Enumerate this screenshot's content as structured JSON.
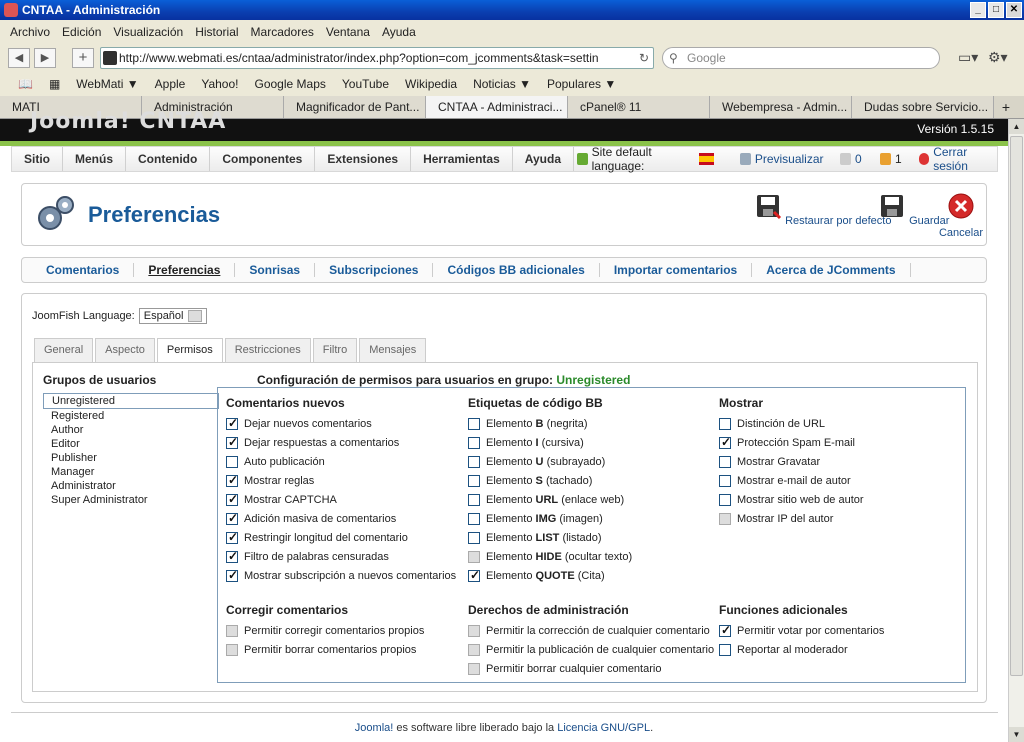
{
  "window": {
    "title": "CNTAA - Administración"
  },
  "menubar": [
    "Archivo",
    "Edición",
    "Visualización",
    "Historial",
    "Marcadores",
    "Ventana",
    "Ayuda"
  ],
  "navbar": {
    "url": "http://www.webmati.es/cntaa/administrator/index.php?option=com_jcomments&task=settin",
    "search_placeholder": "Google"
  },
  "bookmarks": [
    "WebMati ▼",
    "Apple",
    "Yahoo!",
    "Google Maps",
    "YouTube",
    "Wikipedia",
    "Noticias ▼",
    "Populares ▼"
  ],
  "browser_tabs": [
    {
      "label": "MATI",
      "active": false
    },
    {
      "label": "Administración",
      "active": false
    },
    {
      "label": "Magnificador de Pant...",
      "active": false
    },
    {
      "label": "CNTAA - Administraci...",
      "active": true
    },
    {
      "label": "cPanel® 11",
      "active": false
    },
    {
      "label": "Webempresa - Admin...",
      "active": false
    },
    {
      "label": "Dudas sobre Servicio...",
      "active": false
    }
  ],
  "header": {
    "logo": "Joomla! CNTAA",
    "version": "Versión 1.5.15"
  },
  "topmenu": [
    "Sitio",
    "Menús",
    "Contenido",
    "Componentes",
    "Extensiones",
    "Herramientas",
    "Ayuda"
  ],
  "status": {
    "default_language": "Site default language:",
    "preview": "Previsualizar",
    "messages": "0",
    "users": "1",
    "logout": "Cerrar sesión"
  },
  "toolbar": {
    "title": "Preferencias",
    "restore": "Restaurar por defecto",
    "save": "Guardar",
    "cancel": "Cancelar"
  },
  "subtabs": [
    "Comentarios",
    "Preferencias",
    "Sonrisas",
    "Subscripciones",
    "Códigos BB adicionales",
    "Importar comentarios",
    "Acerca de JComments"
  ],
  "joomfish": {
    "label": "JoomFish Language:",
    "value": "Español"
  },
  "content_tabs": [
    "General",
    "Aspecto",
    "Permisos",
    "Restricciones",
    "Filtro",
    "Mensajes"
  ],
  "groups": {
    "title": "Grupos de usuarios",
    "items": [
      "Unregistered",
      "Registered",
      "Author",
      "Editor",
      "Publisher",
      "Manager",
      "Administrator",
      "Super Administrator"
    ]
  },
  "permissions": {
    "title_prefix": "Configuración de permisos para usuarios en grupo:",
    "group": "Unregistered",
    "comments_new": {
      "title": "Comentarios nuevos",
      "items": [
        {
          "label": "Dejar nuevos comentarios",
          "checked": true
        },
        {
          "label": "Dejar respuestas a comentarios",
          "checked": true
        },
        {
          "label": "Auto publicación",
          "checked": false
        },
        {
          "label": "Mostrar reglas",
          "checked": true
        },
        {
          "label": "Mostrar CAPTCHA",
          "checked": true
        },
        {
          "label": "Adición masiva de comentarios",
          "checked": true
        },
        {
          "label": "Restringir longitud del comentario",
          "checked": true
        },
        {
          "label": "Filtro de palabras censuradas",
          "checked": true
        },
        {
          "label": "Mostrar subscripción a nuevos comentarios",
          "checked": true
        }
      ]
    },
    "bb_tags": {
      "title": "Etiquetas de código BB",
      "items": [
        {
          "tag": "B",
          "desc": "(negrita)",
          "checked": false,
          "disabled": false
        },
        {
          "tag": "I",
          "desc": "(cursiva)",
          "checked": false,
          "disabled": false
        },
        {
          "tag": "U",
          "desc": "(subrayado)",
          "checked": false,
          "disabled": false
        },
        {
          "tag": "S",
          "desc": "(tachado)",
          "checked": false,
          "disabled": false
        },
        {
          "tag": "URL",
          "desc": "(enlace web)",
          "checked": false,
          "disabled": false
        },
        {
          "tag": "IMG",
          "desc": "(imagen)",
          "checked": false,
          "disabled": false
        },
        {
          "tag": "LIST",
          "desc": "(listado)",
          "checked": false,
          "disabled": false
        },
        {
          "tag": "HIDE",
          "desc": "(ocultar texto)",
          "checked": false,
          "disabled": true
        },
        {
          "tag": "QUOTE",
          "desc": "(Cita)",
          "checked": true,
          "disabled": false
        }
      ],
      "prefix": "Elemento"
    },
    "show": {
      "title": "Mostrar",
      "items": [
        {
          "label": "Distinción de URL",
          "checked": false,
          "disabled": false
        },
        {
          "label": "Protección Spam E-mail",
          "checked": true,
          "disabled": false
        },
        {
          "label": "Mostrar Gravatar",
          "checked": false,
          "disabled": false
        },
        {
          "label": "Mostrar e-mail de autor",
          "checked": false,
          "disabled": false
        },
        {
          "label": "Mostrar sitio web de autor",
          "checked": false,
          "disabled": false
        },
        {
          "label": "Mostrar IP del autor",
          "checked": false,
          "disabled": true
        }
      ]
    },
    "correct": {
      "title": "Corregir comentarios",
      "items": [
        {
          "label": "Permitir corregir comentarios propios",
          "checked": false,
          "disabled": true
        },
        {
          "label": "Permitir borrar comentarios propios",
          "checked": false,
          "disabled": true
        }
      ]
    },
    "admin": {
      "title": "Derechos de administración",
      "items": [
        {
          "label": "Permitir la corrección de cualquier comentario",
          "checked": false,
          "disabled": true
        },
        {
          "label": "Permitir la publicación de cualquier comentario",
          "checked": false,
          "disabled": true
        },
        {
          "label": "Permitir borrar cualquier comentario",
          "checked": false,
          "disabled": true
        }
      ]
    },
    "extra": {
      "title": "Funciones adicionales",
      "items": [
        {
          "label": "Permitir votar por comentarios",
          "checked": true,
          "disabled": false
        },
        {
          "label": "Reportar al moderador",
          "checked": false,
          "disabled": false
        }
      ]
    }
  },
  "footer": {
    "joomla": "Joomla!",
    "middle": " es software libre liberado bajo la ",
    "license": "Licencia GNU/GPL",
    "end": "."
  }
}
